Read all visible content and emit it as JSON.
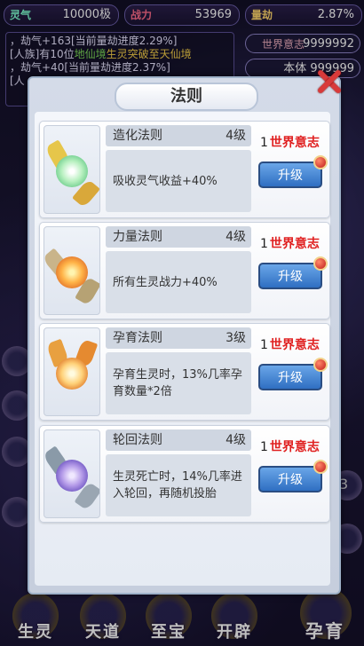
{
  "stats": [
    {
      "label": "灵气",
      "value": "10000极"
    },
    {
      "label": "战力",
      "value": "53969"
    },
    {
      "label": "量劫",
      "value": "2.87%"
    }
  ],
  "log_lines": [
    {
      "prefix": "，劫气+163[当前量劫进度2.29%]",
      "mid": "",
      "mid_color": "",
      "tail": "",
      "tail_color": ""
    },
    {
      "prefix": "[人族]有10位",
      "mid": "地仙境",
      "mid_color": "green",
      "tail": "生灵突破至天仙境",
      "tail_color": "yellow"
    },
    {
      "prefix": "，劫气+40[当前量劫进度2.37%]",
      "mid": "",
      "mid_color": "",
      "tail": "",
      "tail_color": ""
    },
    {
      "prefix": "[人",
      "mid": "",
      "mid_color": "",
      "tail": "",
      "tail_color": ""
    }
  ],
  "world_box": {
    "label": "世界意志",
    "value": "9999992"
  },
  "world_box2": {
    "value": "本体 999999"
  },
  "dialog": {
    "title": "法则",
    "laws": [
      {
        "name": "造化法则",
        "level": "4级",
        "desc": "吸收灵气收益+40%",
        "cost_num": "1",
        "cost_currency": "世界意志",
        "button": "升级"
      },
      {
        "name": "力量法则",
        "level": "4级",
        "desc": "所有生灵战力+40%",
        "cost_num": "1",
        "cost_currency": "世界意志",
        "button": "升级"
      },
      {
        "name": "孕育法则",
        "level": "3级",
        "desc": "孕育生灵时，13%几率孕育数量*2倍",
        "cost_num": "1",
        "cost_currency": "世界意志",
        "button": "升级"
      },
      {
        "name": "轮回法则",
        "level": "4级",
        "desc": "生灵死亡时，14%几率进入轮回，再随机投胎",
        "cost_num": "1",
        "cost_currency": "世界意志",
        "button": "升级"
      }
    ]
  },
  "bottom_nav": [
    "生灵",
    "天道",
    "至宝",
    "开辟",
    "孕育"
  ],
  "side_number": "3",
  "colors": {
    "accent_red": "#e02020",
    "button_blue": "#3f7fd0",
    "panel": "#d4dbe8"
  },
  "icons": {
    "close": "close-x-icon",
    "red_dot": "notification-dot-icon"
  }
}
